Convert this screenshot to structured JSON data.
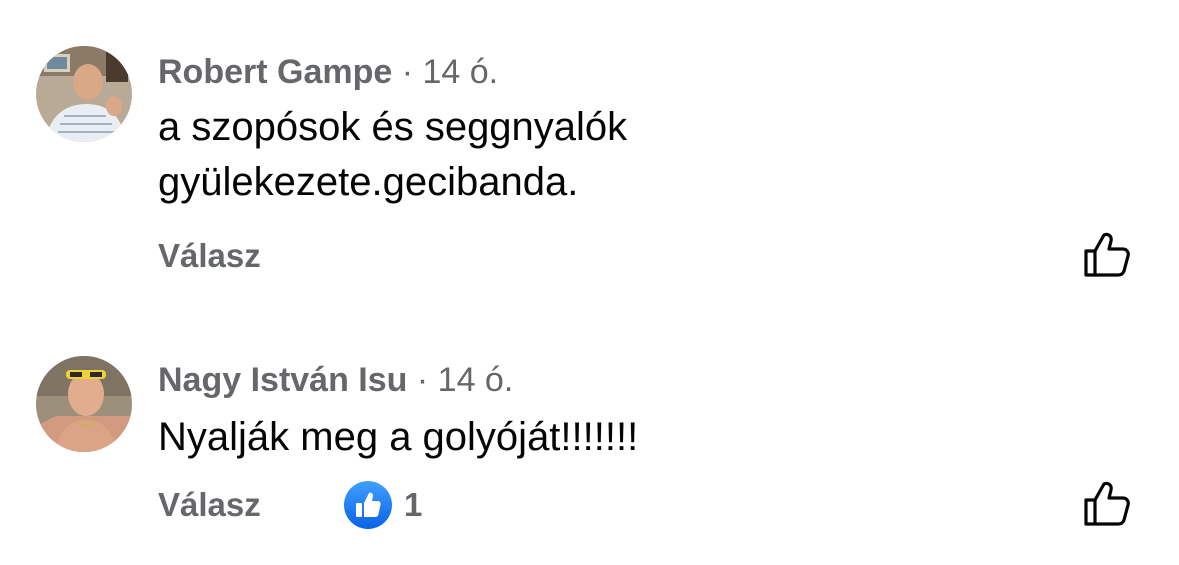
{
  "comments": [
    {
      "author": "Robert Gampe",
      "separator": "·",
      "time": "14 ó.",
      "text_lines": [
        "a szopósok és seggnyalók",
        "gyülekezete.gecibanda."
      ],
      "reply_label": "Válasz",
      "like_icon": "thumbs-up-outline-icon"
    },
    {
      "author": "Nagy István Isu",
      "separator": "·",
      "time": "14 ó.",
      "text_lines": [
        "Nyalják meg a golyóját!!!!!!!"
      ],
      "reply_label": "Válasz",
      "reaction": {
        "icon": "like-reaction-icon",
        "count": "1"
      },
      "like_icon": "thumbs-up-outline-icon"
    }
  ],
  "colors": {
    "secondary_text": "#65676b",
    "primary_text": "#050505",
    "like_blue": "#1877f2"
  }
}
